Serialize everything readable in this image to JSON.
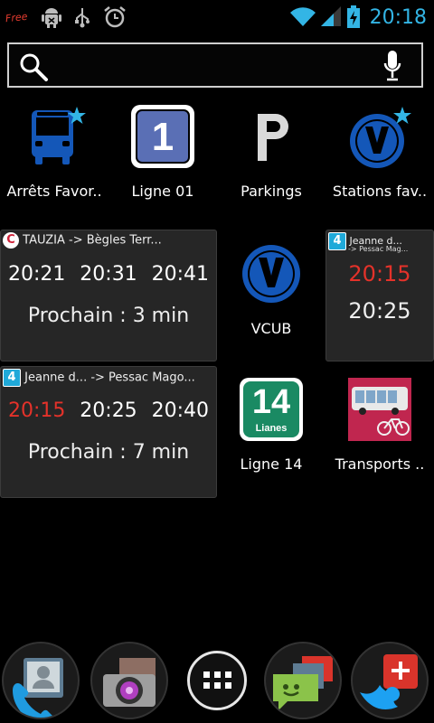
{
  "statusbar": {
    "carrier_logo": "Free",
    "time": "20:18",
    "icons": [
      "android-debug-icon",
      "usb-icon",
      "alarm-icon",
      "wifi-icon",
      "signal-icon",
      "battery-charging-icon"
    ]
  },
  "search": {
    "icon": "search-icon",
    "mic_icon": "microphone-icon"
  },
  "apps": [
    {
      "label": "Arrêts Favor..",
      "icon": "bus-favorite-icon"
    },
    {
      "label": "Ligne 01",
      "icon": "line-01-icon"
    },
    {
      "label": "Parkings",
      "icon": "parking-icon"
    },
    {
      "label": "Stations fav..",
      "icon": "vcub-favorite-icon"
    },
    {
      "label": "VCUB",
      "icon": "vcub-icon"
    },
    {
      "label": "Ligne 14",
      "icon": "line-14-icon"
    },
    {
      "label": "Transports ..",
      "icon": "transports-icon"
    }
  ],
  "line14_icon": {
    "number": "14",
    "sub": "Lianes"
  },
  "line01_icon": {
    "number": "1"
  },
  "widgets": {
    "tauzia": {
      "badge": "C",
      "title": "TAUZIA   -> Bègles Terr...",
      "times": [
        "20:21",
        "20:31",
        "20:41"
      ],
      "next": "Prochain : 3 min"
    },
    "jeanne_large": {
      "badge": "4",
      "title": "Jeanne d...   -> Pessac Mago...",
      "times": [
        "20:15",
        "20:25",
        "20:40"
      ],
      "next": "Prochain : 7 min"
    },
    "jeanne_small": {
      "badge": "4",
      "title": "Jeanne d...",
      "subtitle": "-> Pessac Mag...",
      "times": [
        "20:15",
        "20:25"
      ]
    }
  },
  "colors": {
    "accent": "#33b5e5",
    "alert_red": "#e4322a",
    "tbc_blue": "#1457b8"
  },
  "dock": [
    "phone-contacts-icon",
    "camera-gallery-icon",
    "all-apps-icon",
    "messaging-icon",
    "social-apps-icon"
  ]
}
